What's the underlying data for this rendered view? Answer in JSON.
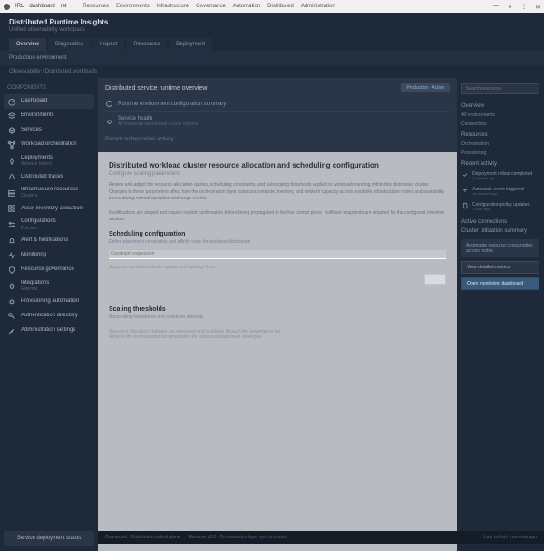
{
  "titlebar": {
    "app": "IRL",
    "doc": "dashboard",
    "ext": "rst",
    "menu": [
      "Resources",
      "Environments",
      "Infrastructure",
      "Governance",
      "Automation",
      "Distributed",
      "Administration"
    ],
    "controls": [
      "—",
      "✕",
      "⋮",
      "⊟"
    ]
  },
  "header": {
    "title": "Distributed Runtime Insights",
    "subtitle": "Unified observability workspace",
    "tabs": [
      "Overview",
      "Diagnostics",
      "Inspect",
      "Resources",
      "Deployment"
    ]
  },
  "subheader": "Production environment",
  "breadcrumb": "Observability / Distributed workloads",
  "sidebar": {
    "heading": "Components",
    "items": [
      {
        "label": "Dashboard",
        "icon": "gauge"
      },
      {
        "label": "Environments",
        "icon": "layers"
      },
      {
        "label": "Services",
        "icon": "cube"
      },
      {
        "label": "Workload orchestration",
        "icon": "nodes"
      },
      {
        "label": "Deployments",
        "sub": "Release history",
        "icon": "rocket"
      },
      {
        "label": "Distributed traces",
        "icon": "route"
      },
      {
        "label": "Infrastructure resources",
        "sub": "Clusters",
        "icon": "server"
      },
      {
        "label": "Asset inventory allocation",
        "icon": "grid"
      },
      {
        "label": "Configurations",
        "sub": "Policies",
        "icon": "sliders"
      },
      {
        "label": "Alert & Notifications",
        "icon": "bell"
      },
      {
        "label": "Monitoring",
        "icon": "pulse"
      },
      {
        "label": "Resource governance",
        "icon": "shield"
      },
      {
        "label": "Integrations",
        "sub": "External",
        "icon": "plug"
      },
      {
        "label": "Provisioning automation",
        "icon": "gear"
      },
      {
        "label": "Authentication directory",
        "icon": "key"
      },
      {
        "label": "Administration settings",
        "icon": "wrench"
      }
    ],
    "footer": "Service deployment status"
  },
  "main": {
    "title": "Distributed service runtime overview",
    "badge": "Production · Active",
    "rows": [
      {
        "label": "Runtime environment configuration summary",
        "sub": "",
        "icon": "info"
      },
      {
        "label": "Service health",
        "sub": "All instances operational across regions",
        "icon": "heart"
      }
    ],
    "section": "Recent orchestration activity"
  },
  "modal": {
    "title": "Distributed workload cluster resource allocation and scheduling configuration",
    "subtitle": "Configure scaling parameters",
    "body1": "Review and adjust the resource allocation quotas, scheduling constraints, and autoscaling thresholds applied to workloads running within this distributed cluster. Changes to these parameters affect how the orchestration layer balances compute, memory, and network capacity across available infrastructure nodes and availability zones during normal operation and surge events.",
    "body2": "Modifications are staged and require explicit confirmation before being propagated to the live control plane. Rollback snapshots are retained for the configured retention window.",
    "h2a": "Scheduling configuration",
    "line_a": "Define placement constraints and affinity rules for workload distribution",
    "input_placeholder": "Constraint expression",
    "hint": "Supports standard selector syntax and topology keys",
    "h2b": "Scaling thresholds",
    "line_b": "Autoscaling boundaries and cooldown intervals",
    "footer_lines": [
      "Resource allocation changes are versioned and auditable through the governance log",
      "Refer to the orchestration documentation for advanced placement strategies"
    ]
  },
  "rightbar": {
    "search_placeholder": "Search resources",
    "h1": "Overview",
    "links1": [
      "All environments",
      "Connections"
    ],
    "h2": "Resources",
    "links2": [
      "Orchestration",
      "Provisioning"
    ],
    "h3": "Recent activity",
    "items": [
      {
        "label": "Deployment rollout completed",
        "sub": "2 minutes ago",
        "icon": "check"
      },
      {
        "label": "Autoscale event triggered",
        "sub": "14 minutes ago",
        "icon": "scale"
      },
      {
        "label": "Configuration policy updated",
        "sub": "1 hour ago",
        "icon": "doc"
      }
    ],
    "stat_label": "Active connections",
    "h4": "Cluster utilization summary",
    "box": "Aggregate resource consumption across nodes",
    "btn1": "View detailed metrics",
    "btn2": "Open monitoring dashboard"
  },
  "bottombar": {
    "left": "Connected · Distributed control plane",
    "mid": "Runtime v3.2 · Orchestration layer synchronized",
    "right": "Last refresh moments ago"
  }
}
